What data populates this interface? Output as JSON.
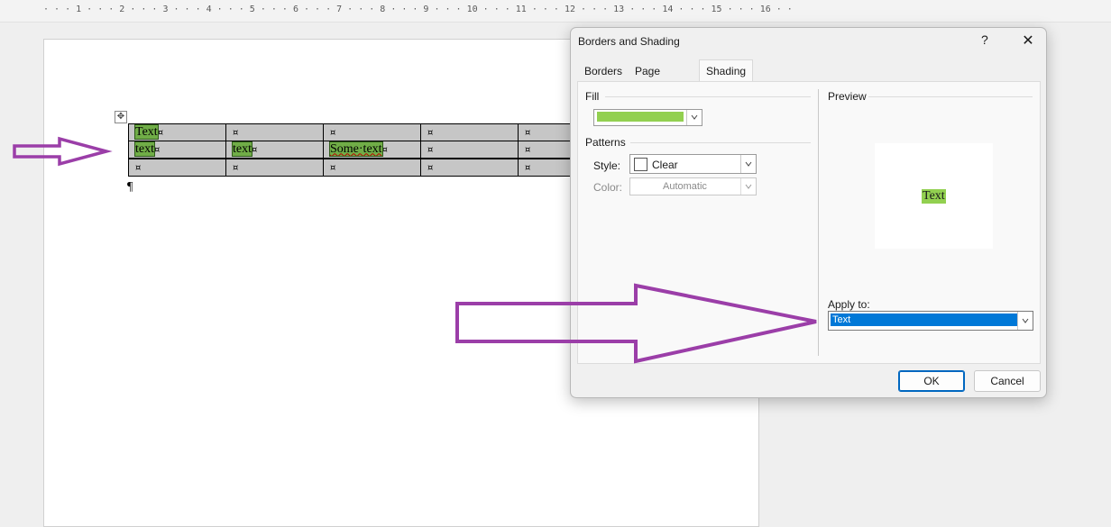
{
  "ruler": {
    "text": "· · · 1 · · · 2 · · · 3 · · · 4 · · · 5 · · · 6 · · · 7 · · · 8 · · · 9 · · · 10 · · · 11 · · · 12 · · · 13 · · · 14 · · · 15 · · · 16 · ·"
  },
  "document": {
    "table": {
      "rows": [
        [
          "Text",
          "",
          "",
          "",
          ""
        ],
        [
          "text",
          "text",
          "Some·text",
          "",
          ""
        ],
        [
          "",
          "",
          "",
          "",
          ""
        ]
      ],
      "cell_end_mark": "¤"
    },
    "paragraph_mark": "¶",
    "move_handle_glyph": "✥"
  },
  "dialog": {
    "title": "Borders and Shading",
    "help": "?",
    "close": "✕",
    "tabs": [
      "Borders",
      "Page Border",
      "Shading"
    ],
    "active_tab": "Shading",
    "fill": {
      "label": "Fill",
      "color": "#92d050"
    },
    "patterns": {
      "label": "Patterns",
      "style_label": "Style:",
      "style_value": "Clear",
      "color_label": "Color:",
      "color_value": "Automatic"
    },
    "preview": {
      "label": "Preview",
      "sample_text": "Text"
    },
    "apply_to": {
      "label": "Apply to:",
      "value": "Text"
    },
    "ok": "OK",
    "cancel": "Cancel"
  },
  "colors": {
    "annotation_arrow": "#9b3ea8",
    "cell_highlight": "#70ad47",
    "fill_green": "#92d050",
    "selection_blue": "#0078d7"
  },
  "icons": {
    "dropdown": "chevron-down-icon",
    "move": "move-icon",
    "close": "close-icon",
    "help": "help-icon"
  }
}
